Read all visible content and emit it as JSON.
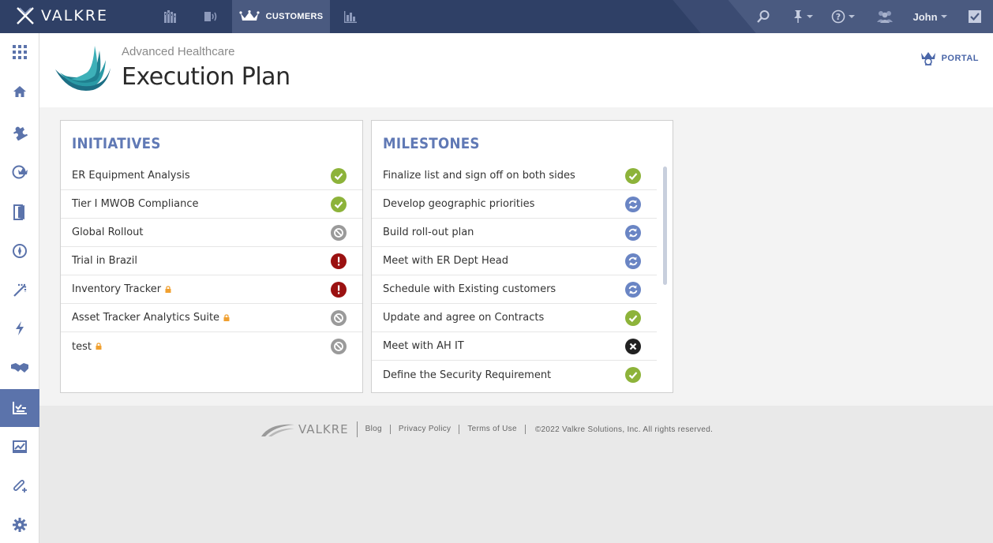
{
  "brand": {
    "name": "VALKRE"
  },
  "topnav": {
    "items": [
      {
        "icon": "building-icon"
      },
      {
        "icon": "broadcast-icon"
      },
      {
        "icon": "crown-icon",
        "label": "CUSTOMERS",
        "active": true
      },
      {
        "icon": "bar-chart-icon"
      }
    ]
  },
  "toolbar": {
    "user_name": "John"
  },
  "header": {
    "company": "Advanced Healthcare",
    "title": "Execution Plan",
    "portal_label": "PORTAL"
  },
  "initiatives": {
    "title": "INITIATIVES",
    "items": [
      {
        "label": "ER Equipment Analysis",
        "status": "complete",
        "locked": false
      },
      {
        "label": "Tier I MWOB Compliance",
        "status": "complete",
        "locked": false
      },
      {
        "label": "Global Rollout",
        "status": "not-started",
        "locked": false
      },
      {
        "label": "Trial in Brazil",
        "status": "at-risk",
        "locked": false
      },
      {
        "label": "Inventory Tracker",
        "status": "at-risk",
        "locked": true
      },
      {
        "label": "Asset Tracker Analytics Suite",
        "status": "not-started",
        "locked": true
      },
      {
        "label": "test",
        "status": "not-started",
        "locked": true
      }
    ]
  },
  "milestones": {
    "title": "MILESTONES",
    "items": [
      {
        "label": "Finalize list and sign off on both sides",
        "status": "complete"
      },
      {
        "label": "Develop geographic priorities",
        "status": "in-progress"
      },
      {
        "label": "Build roll-out plan",
        "status": "in-progress"
      },
      {
        "label": "Meet with ER Dept Head",
        "status": "in-progress"
      },
      {
        "label": "Schedule with Existing customers",
        "status": "in-progress"
      },
      {
        "label": "Update and agree on Contracts",
        "status": "complete"
      },
      {
        "label": "Meet with AH IT",
        "status": "cancelled"
      },
      {
        "label": "Define the Security Requirement",
        "status": "complete"
      }
    ]
  },
  "footer": {
    "brand": "VALKRE",
    "links": [
      "Blog",
      "Privacy Policy",
      "Terms of Use"
    ],
    "copyright": "©2022 Valkre Solutions, Inc. All rights reserved."
  },
  "colors": {
    "topbar": "#2f4066",
    "accent": "#5b73ab",
    "complete": "#8db33a",
    "in-progress": "#6a85c4",
    "at-risk": "#9b1111",
    "not-started": "#9a9a9a",
    "cancelled": "#222222"
  }
}
